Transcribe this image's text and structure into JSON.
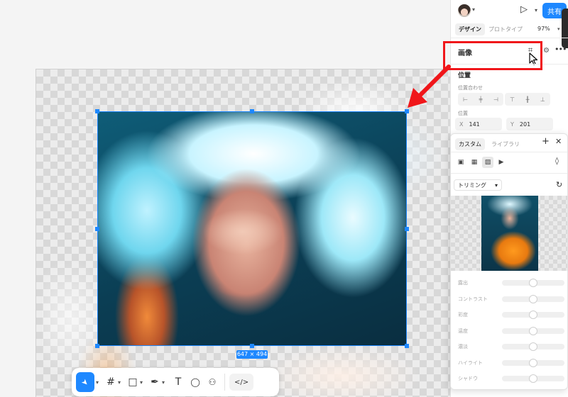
{
  "canvas": {
    "selection_size": "647 × 494"
  },
  "toolbar": {
    "tools": [
      {
        "name": "move",
        "icon": "cursor-arrow-icon",
        "glyph": "➤"
      },
      {
        "name": "frame",
        "icon": "frame-hash-icon",
        "glyph": "#"
      },
      {
        "name": "shape",
        "icon": "rectangle-icon",
        "glyph": "□"
      },
      {
        "name": "pen",
        "icon": "pen-icon",
        "glyph": "✒"
      },
      {
        "name": "text",
        "icon": "text-icon",
        "glyph": "T"
      },
      {
        "name": "comment",
        "icon": "comment-bubble-icon",
        "glyph": "◯"
      },
      {
        "name": "components",
        "icon": "components-icon",
        "glyph": "⚇"
      },
      {
        "name": "dev",
        "icon": "code-icon",
        "glyph": "</>"
      }
    ],
    "caret": "▾"
  },
  "header": {
    "share_label": "共有",
    "play_glyph": "▷",
    "tabs": [
      {
        "label": "デザイン",
        "active": true
      },
      {
        "label": "プロトタイプ",
        "active": false
      }
    ],
    "zoom": "97%"
  },
  "image_section": {
    "title": "画像"
  },
  "position_section": {
    "title": "位置",
    "align_label": "位置合わせ",
    "position_label": "位置",
    "x_axis": "X",
    "x_value": "141",
    "y_axis": "Y",
    "y_value": "201"
  },
  "fill_popup": {
    "tabs": [
      {
        "label": "カスタム",
        "active": true
      },
      {
        "label": "ライブラリ",
        "active": false
      }
    ],
    "mode": "トリミング",
    "sliders": [
      {
        "label": "露出",
        "level": 0.5
      },
      {
        "label": "コントラスト",
        "level": 0.5
      },
      {
        "label": "彩度",
        "level": 0.5
      },
      {
        "label": "温度",
        "level": 0.5
      },
      {
        "label": "濃淡",
        "level": 0.5
      },
      {
        "label": "ハイライト",
        "level": 0.5
      },
      {
        "label": "シャドウ",
        "level": 0.5
      }
    ]
  },
  "colors": {
    "accent": "#1e88ff",
    "annotation_red": "#f0161a"
  }
}
